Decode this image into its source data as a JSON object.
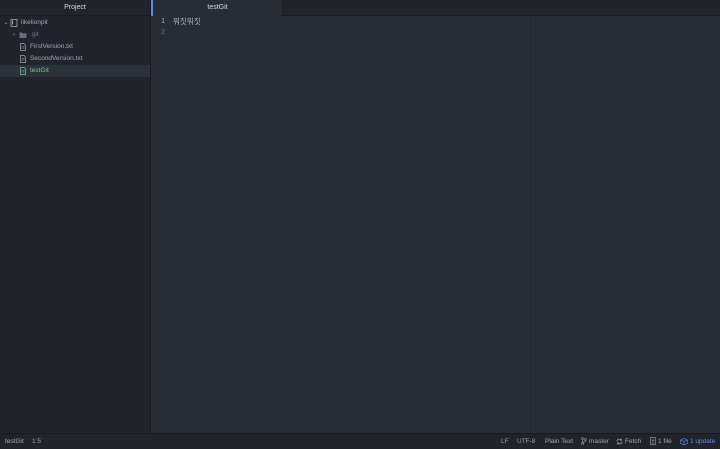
{
  "sidebar": {
    "tab_label": "Project",
    "root": {
      "label": "likelionpit"
    },
    "items": [
      {
        "label": ".git",
        "type": "folder"
      },
      {
        "label": "FirstVersion.txt",
        "type": "file"
      },
      {
        "label": "SecondVersion.txt",
        "type": "file"
      },
      {
        "label": "testGit",
        "type": "file",
        "selected": true
      }
    ]
  },
  "editor": {
    "tab_label": "testGit",
    "lines": [
      {
        "number": "1",
        "text": "뭐짓뭐짓"
      },
      {
        "number": "2",
        "text": ""
      }
    ]
  },
  "statusbar": {
    "file": "testGit",
    "cursor": "1:5",
    "line_ending": "LF",
    "encoding": "UTF-8",
    "grammar": "Plain Text",
    "branch": "master",
    "fetch": "Fetch",
    "changed_files": "1 file",
    "updates": "1 update"
  },
  "colors": {
    "accent": "#568af2",
    "added": "#73c990",
    "background": "#282c34",
    "panel": "#21252b"
  }
}
